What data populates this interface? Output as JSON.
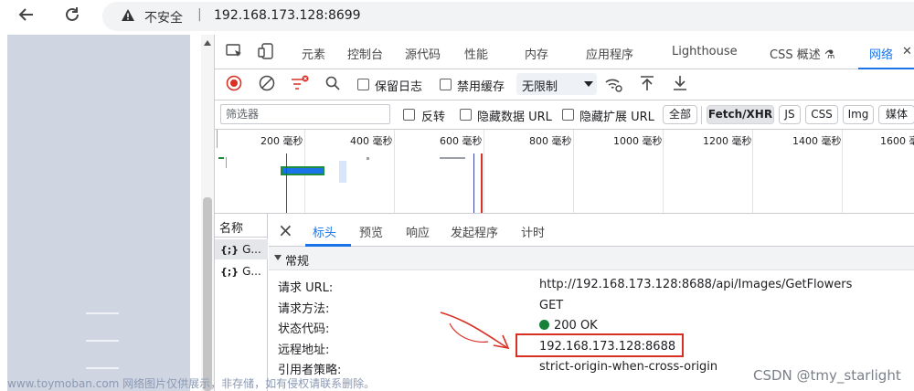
{
  "browser": {
    "insecure_label": "不安全",
    "separator": "|",
    "url": "192.168.173.128:8699"
  },
  "devtools": {
    "tabs": [
      "元素",
      "控制台",
      "源代码",
      "性能",
      "内存",
      "应用程序",
      "Lighthouse",
      "CSS 概述 ⚗",
      "网络"
    ],
    "active_tab": "网络",
    "close_glyph": "✕"
  },
  "network_toolbar": {
    "preserve_log": "保留日志",
    "disable_cache": "禁用缓存",
    "throttle": "无限制"
  },
  "filter_bar": {
    "placeholder": "筛选器",
    "invert": "反转",
    "hide_data_url": "隐藏数据 URL",
    "hide_extension_url": "隐藏扩展 URL",
    "types": [
      "全部",
      "Fetch/XHR",
      "JS",
      "CSS",
      "Img",
      "媒体"
    ],
    "selected_type": "Fetch/XHR"
  },
  "timeline": {
    "ticks": [
      "200 毫秒",
      "400 毫秒",
      "600 毫秒",
      "800 毫秒",
      "1000 毫秒",
      "1200 毫秒",
      "1400 毫秒",
      "1600 毫秒"
    ]
  },
  "request_list": {
    "header": "名称",
    "rows": [
      {
        "icon": "{;}",
        "name": "G..."
      },
      {
        "icon": "{;}",
        "name": "G..."
      }
    ]
  },
  "details": {
    "tabs": [
      "标头",
      "预览",
      "响应",
      "发起程序",
      "计时"
    ],
    "active_tab": "标头",
    "section_title": "常规",
    "general": [
      {
        "key": "请求 URL:",
        "value": "http://192.168.173.128:8688/api/Images/GetFlowers"
      },
      {
        "key": "请求方法:",
        "value": "GET"
      },
      {
        "key": "状态代码:",
        "value": "200 OK"
      },
      {
        "key": "远程地址:",
        "value": "192.168.173.128:8688"
      },
      {
        "key": "引用者策略:",
        "value": "strict-origin-when-cross-origin"
      }
    ],
    "status_color": "#188038"
  },
  "annotation": {
    "box_color": "#d93025"
  },
  "watermarks": {
    "left": "www.toymoban.com 网络图片仅供展示，非存储，如有侵权请联系删除。",
    "right": "CSDN @tmy_starlight"
  }
}
